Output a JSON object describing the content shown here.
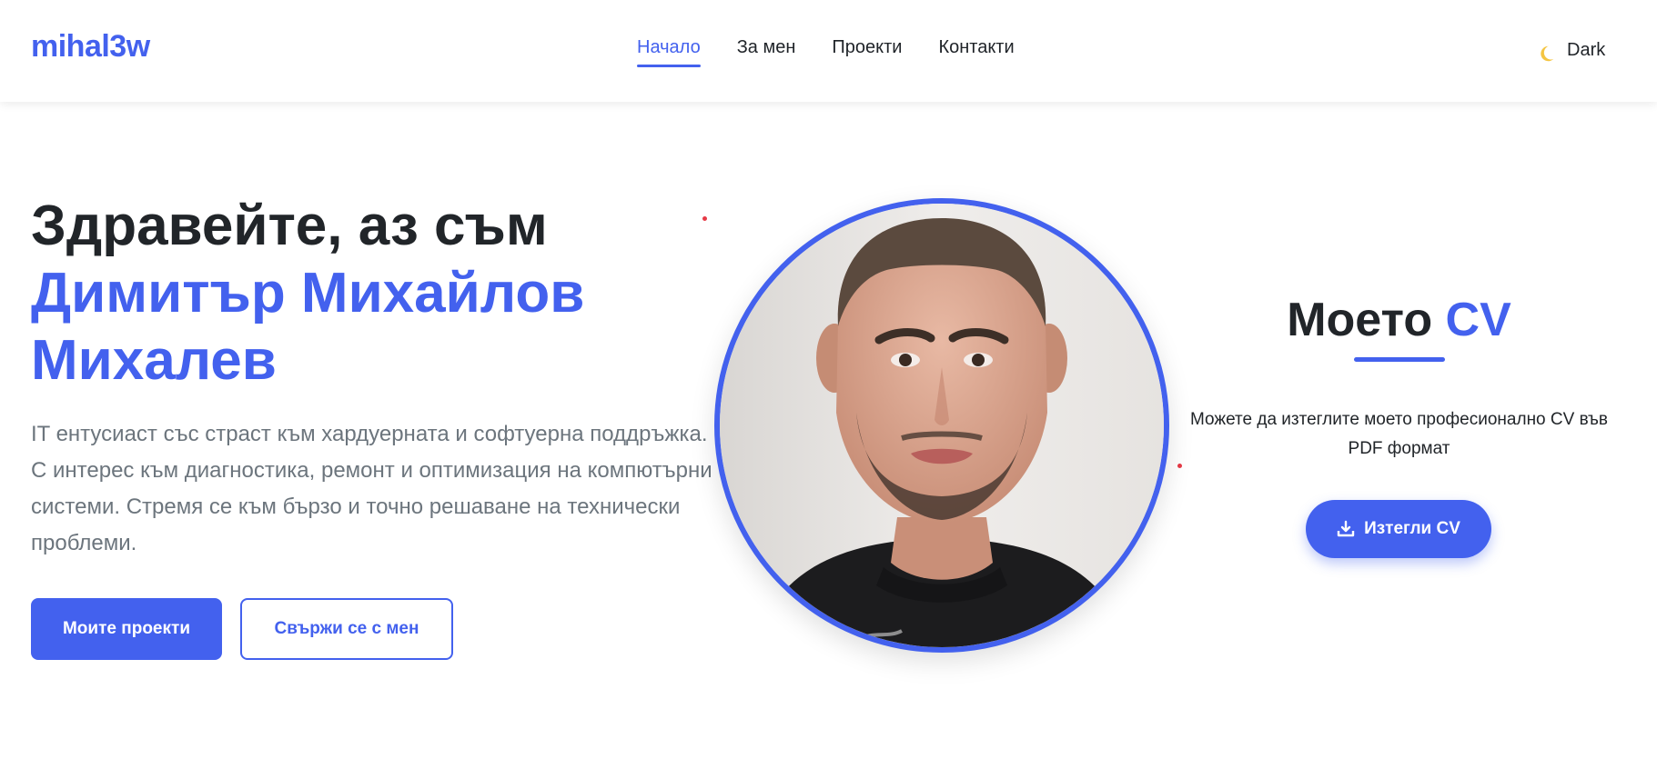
{
  "brand": {
    "logo": "mihal3w",
    "accent_color": "#4361ee"
  },
  "nav": {
    "links": [
      {
        "label": "Начало",
        "active": true
      },
      {
        "label": "За мен",
        "active": false
      },
      {
        "label": "Проекти",
        "active": false
      },
      {
        "label": "Контакти",
        "active": false
      }
    ],
    "theme_toggle": {
      "icon": "moon-icon",
      "label": "Dark"
    }
  },
  "hero": {
    "greeting": "Здравейте, аз съм",
    "name_line1": "Димитър Михайлов",
    "name_line2": "Михалев",
    "description": "IT ентусиаст със страст към хардуерната и софтуерна поддръжка. С интерес към диагностика, ремонт и оптимизация на компютърни системи. Стремя се към бързо и точно решаване на технически проблеми.",
    "primary_button": "Моите проекти",
    "secondary_button": "Свържи се с мен"
  },
  "cv": {
    "title_prefix": "Моето",
    "title_accent": "CV",
    "description": "Можете да изтеглите моето професионално CV във PDF формат",
    "download_button": "Изтегли CV",
    "download_icon": "download-icon"
  }
}
